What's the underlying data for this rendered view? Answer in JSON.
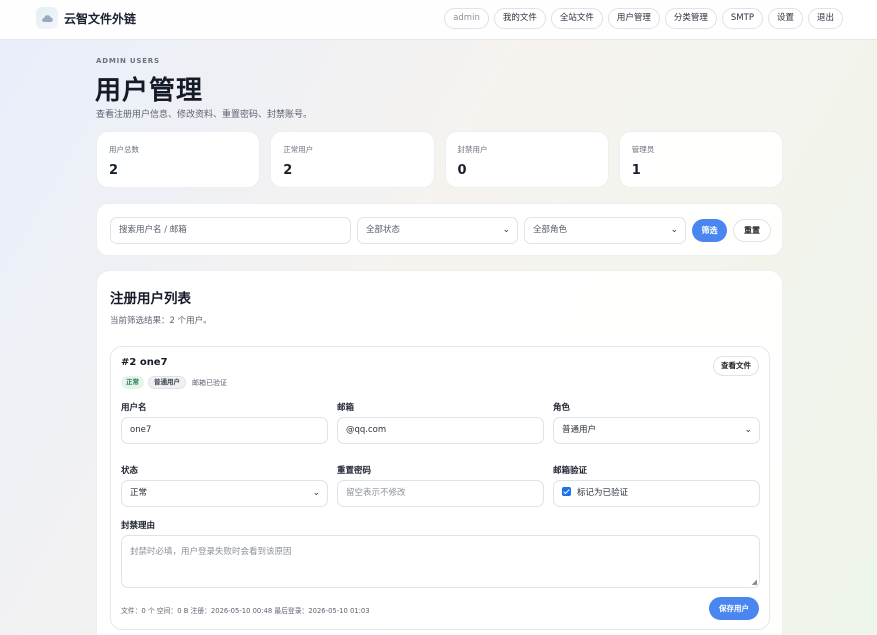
{
  "brand": {
    "name": "云智文件外链"
  },
  "nav": {
    "admin": "admin",
    "items": [
      "我的文件",
      "全站文件",
      "用户管理",
      "分类管理",
      "SMTP",
      "设置",
      "退出"
    ]
  },
  "header": {
    "eyebrow": "ADMIN USERS",
    "title": "用户管理",
    "subtitle": "查看注册用户信息、修改资料、重置密码、封禁账号。"
  },
  "stats": [
    {
      "label": "用户总数",
      "value": "2"
    },
    {
      "label": "正常用户",
      "value": "2"
    },
    {
      "label": "封禁用户",
      "value": "0"
    },
    {
      "label": "管理员",
      "value": "1"
    }
  ],
  "filter": {
    "search_placeholder": "搜索用户名 / 邮箱",
    "status_selected": "全部状态",
    "role_selected": "全部角色",
    "filter_label": "筛选",
    "reset_label": "重置"
  },
  "list": {
    "title": "注册用户列表",
    "summary": "当前筛选结果：2 个用户。"
  },
  "user": {
    "heading": "#2 one7",
    "status_badge": "正常",
    "role_badge": "普通用户",
    "verified_text": "邮箱已验证",
    "view_files": "查看文件",
    "username_label": "用户名",
    "username_value": "one7",
    "email_label": "邮箱",
    "email_value": "@qq.com",
    "role_label": "角色",
    "role_value": "普通用户",
    "status_label": "状态",
    "status_value": "正常",
    "password_label": "重置密码",
    "password_placeholder": "留空表示不修改",
    "verify_label": "邮箱验证",
    "verify_checkbox": "标记为已验证",
    "verified_checked": true,
    "ban_label": "封禁理由",
    "ban_placeholder": "封禁时必填，用户登录失败时会看到该原因",
    "meta": "文件：0 个  空间：0 B  注册：2026-05-10 00:48  最后登录：2026-05-10 01:03",
    "save": "保存用户"
  },
  "colors": {
    "accent": "#4a86f0",
    "ok_bg": "#e3f5ea",
    "ok_text": "#2a7a48"
  },
  "icons": {
    "logo": "cloud-icon",
    "select": "chevron-down-icon"
  }
}
